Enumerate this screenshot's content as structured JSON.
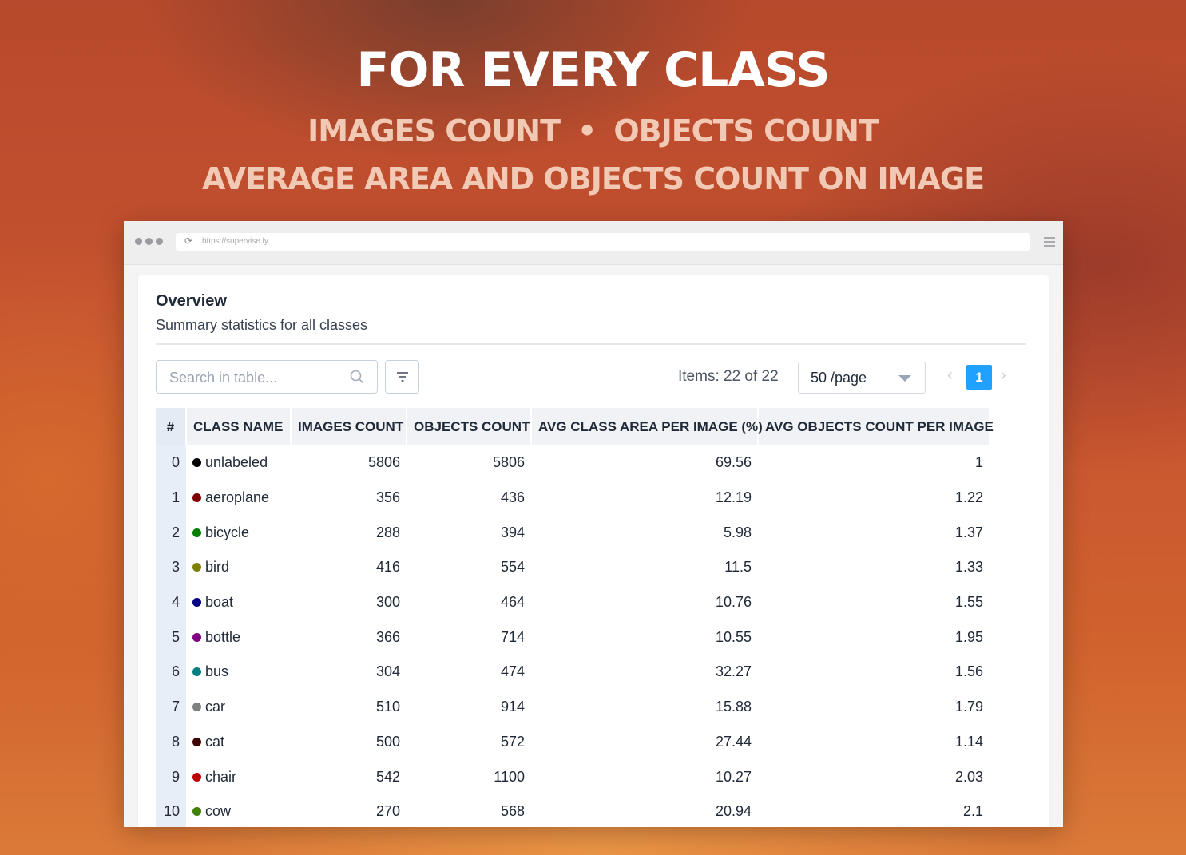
{
  "hero": {
    "title": "FOR EVERY CLASS",
    "line1_left": "IMAGES COUNT",
    "line1_sep": "•",
    "line1_right": "OBJECTS COUNT",
    "line2": "AVERAGE AREA AND OBJECTS COUNT ON IMAGE"
  },
  "browser": {
    "url": "https://supervise.ly",
    "reload_icon": "reload-icon",
    "menu_icon": "hamburger-menu-icon"
  },
  "overview": {
    "title": "Overview",
    "subtitle": "Summary statistics for all classes"
  },
  "toolbar": {
    "search_placeholder": "Search in table...",
    "search_icon": "search-icon",
    "filter_icon": "filter-icon",
    "items_text": "Items: 22 of 22",
    "page_size": "50 /page",
    "prev_label": "‹",
    "current_page": "1",
    "next_label": "›"
  },
  "table": {
    "headers": [
      "#",
      "CLASS NAME",
      "IMAGES COUNT",
      "OBJECTS COUNT",
      "AVG CLASS AREA PER IMAGE (%)",
      "AVG OBJECTS COUNT PER IMAGE"
    ],
    "rows": [
      {
        "idx": "0",
        "name": "unlabeled",
        "color": "#000000",
        "images": "5806",
        "objects": "5806",
        "area": "69.56",
        "avg_objects": "1"
      },
      {
        "idx": "1",
        "name": "aeroplane",
        "color": "#800000",
        "images": "356",
        "objects": "436",
        "area": "12.19",
        "avg_objects": "1.22"
      },
      {
        "idx": "2",
        "name": "bicycle",
        "color": "#008000",
        "images": "288",
        "objects": "394",
        "area": "5.98",
        "avg_objects": "1.37"
      },
      {
        "idx": "3",
        "name": "bird",
        "color": "#808000",
        "images": "416",
        "objects": "554",
        "area": "11.5",
        "avg_objects": "1.33"
      },
      {
        "idx": "4",
        "name": "boat",
        "color": "#000080",
        "images": "300",
        "objects": "464",
        "area": "10.76",
        "avg_objects": "1.55"
      },
      {
        "idx": "5",
        "name": "bottle",
        "color": "#800080",
        "images": "366",
        "objects": "714",
        "area": "10.55",
        "avg_objects": "1.95"
      },
      {
        "idx": "6",
        "name": "bus",
        "color": "#008080",
        "images": "304",
        "objects": "474",
        "area": "32.27",
        "avg_objects": "1.56"
      },
      {
        "idx": "7",
        "name": "car",
        "color": "#808080",
        "images": "510",
        "objects": "914",
        "area": "15.88",
        "avg_objects": "1.79"
      },
      {
        "idx": "8",
        "name": "cat",
        "color": "#400000",
        "images": "500",
        "objects": "572",
        "area": "27.44",
        "avg_objects": "1.14"
      },
      {
        "idx": "9",
        "name": "chair",
        "color": "#c00000",
        "images": "542",
        "objects": "1100",
        "area": "10.27",
        "avg_objects": "2.03"
      },
      {
        "idx": "10",
        "name": "cow",
        "color": "#408000",
        "images": "270",
        "objects": "568",
        "area": "20.94",
        "avg_objects": "2.1"
      }
    ]
  },
  "colors": {
    "accent": "#20a0ff",
    "header_bg": "#f0f2f5",
    "index_bg": "#e8eef7"
  }
}
